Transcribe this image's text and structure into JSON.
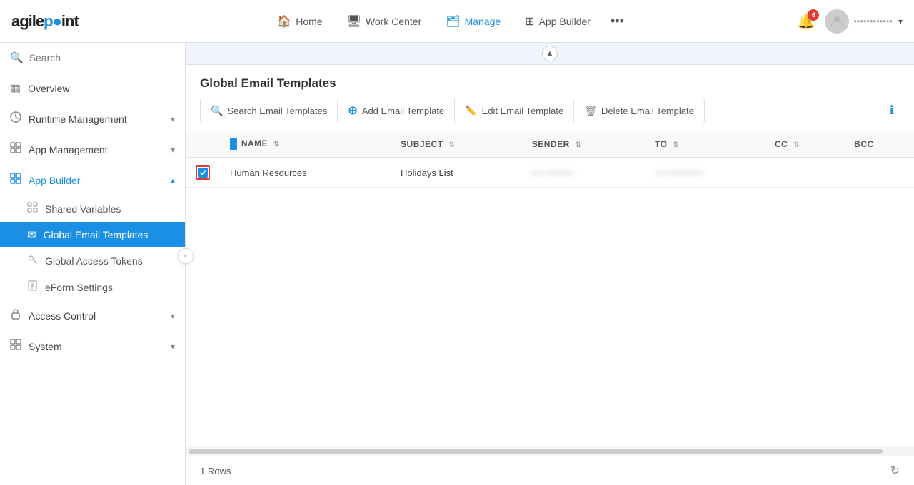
{
  "app": {
    "logo": "agilepoint",
    "logo_dot_char": "●"
  },
  "topnav": {
    "items": [
      {
        "id": "home",
        "label": "Home",
        "icon": "🏠",
        "active": false
      },
      {
        "id": "workcenter",
        "label": "Work Center",
        "icon": "🖥",
        "active": false
      },
      {
        "id": "manage",
        "label": "Manage",
        "icon": "🗂",
        "active": true
      },
      {
        "id": "appbuilder",
        "label": "App Builder",
        "icon": "⊞",
        "active": false
      }
    ],
    "more_icon": "•••",
    "bell_count": "6",
    "user_name": "••••••••••••",
    "chevron": "▾"
  },
  "sidebar": {
    "search_placeholder": "Search",
    "items": [
      {
        "id": "overview",
        "label": "Overview",
        "icon": "▦",
        "type": "section",
        "expanded": false
      },
      {
        "id": "runtime",
        "label": "Runtime Management",
        "icon": "🕐",
        "type": "section",
        "expanded": false
      },
      {
        "id": "appmanagement",
        "label": "App Management",
        "icon": "🗃",
        "type": "section",
        "expanded": false
      },
      {
        "id": "appbuilder",
        "label": "App Builder",
        "icon": "⊞",
        "type": "section",
        "expanded": true
      }
    ],
    "app_builder_children": [
      {
        "id": "shared-vars",
        "label": "Shared Variables",
        "icon": "▦",
        "active": false
      },
      {
        "id": "global-email",
        "label": "Global Email Templates",
        "icon": "✉",
        "active": true
      },
      {
        "id": "global-access",
        "label": "Global Access Tokens",
        "icon": "🔧",
        "active": false
      },
      {
        "id": "eform",
        "label": "eForm Settings",
        "icon": "📄",
        "active": false
      }
    ],
    "bottom_items": [
      {
        "id": "access-control",
        "label": "Access Control",
        "icon": "🔒",
        "type": "section",
        "expanded": false
      },
      {
        "id": "system",
        "label": "System",
        "icon": "⊞",
        "type": "section",
        "expanded": false
      }
    ]
  },
  "content": {
    "title": "Global Email Templates",
    "toolbar": {
      "search_label": "Search Email Templates",
      "add_label": "Add Email Template",
      "edit_label": "Edit Email Template",
      "delete_label": "Delete Email Template"
    },
    "table": {
      "columns": [
        {
          "id": "name",
          "label": "NAME"
        },
        {
          "id": "subject",
          "label": "SUBJECT"
        },
        {
          "id": "sender",
          "label": "SENDER"
        },
        {
          "id": "to",
          "label": "TO"
        },
        {
          "id": "cc",
          "label": "CC"
        },
        {
          "id": "bcc",
          "label": "BCC"
        }
      ],
      "rows": [
        {
          "selected": true,
          "name": "Human Resources",
          "subject": "Holidays List",
          "sender": "•••• ••••••••",
          "to": "•••• ••••••••••",
          "cc": "",
          "bcc": ""
        }
      ]
    },
    "footer": {
      "rows_count": "1 Rows"
    }
  }
}
